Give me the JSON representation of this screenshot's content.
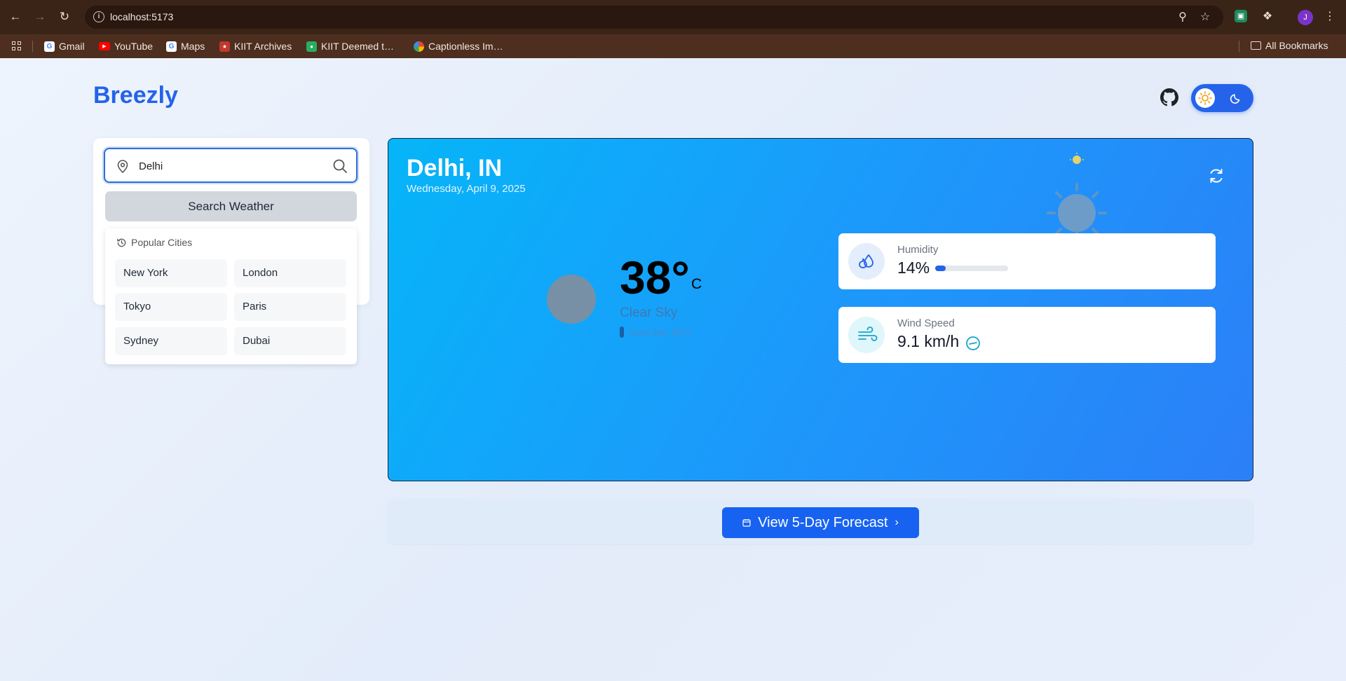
{
  "browser": {
    "url": "localhost:5173",
    "profile_initial": "J",
    "bookmarks": [
      {
        "label": "Gmail",
        "icon": "google-icon"
      },
      {
        "label": "YouTube",
        "icon": "youtube-icon"
      },
      {
        "label": "Maps",
        "icon": "google-icon"
      },
      {
        "label": "KIIT Archives",
        "icon": "kiit-icon"
      },
      {
        "label": "KIIT Deemed t…",
        "icon": "kiit-icon"
      },
      {
        "label": "Captionless Im…",
        "icon": "photos-icon"
      }
    ],
    "all_bookmarks": "All Bookmarks"
  },
  "app": {
    "logo": "Breezly",
    "accent": "#2563eb"
  },
  "search": {
    "value": "Delhi",
    "button_label": "Search Weather"
  },
  "popular": {
    "title": "Popular Cities",
    "cities": [
      "New York",
      "London",
      "Tokyo",
      "Paris",
      "Sydney",
      "Dubai"
    ]
  },
  "weather": {
    "city": "Delhi, IN",
    "date": "Wednesday, April 9, 2025",
    "temp": "38°",
    "unit": "C",
    "description": "Clear Sky",
    "feels_like": "Feels like: 35°C",
    "humidity": {
      "label": "Humidity",
      "value": "14%",
      "percent": 14
    },
    "wind": {
      "label": "Wind Speed",
      "value": "9.1 km/h"
    }
  },
  "forecast": {
    "button_label": "View 5-Day Forecast"
  }
}
